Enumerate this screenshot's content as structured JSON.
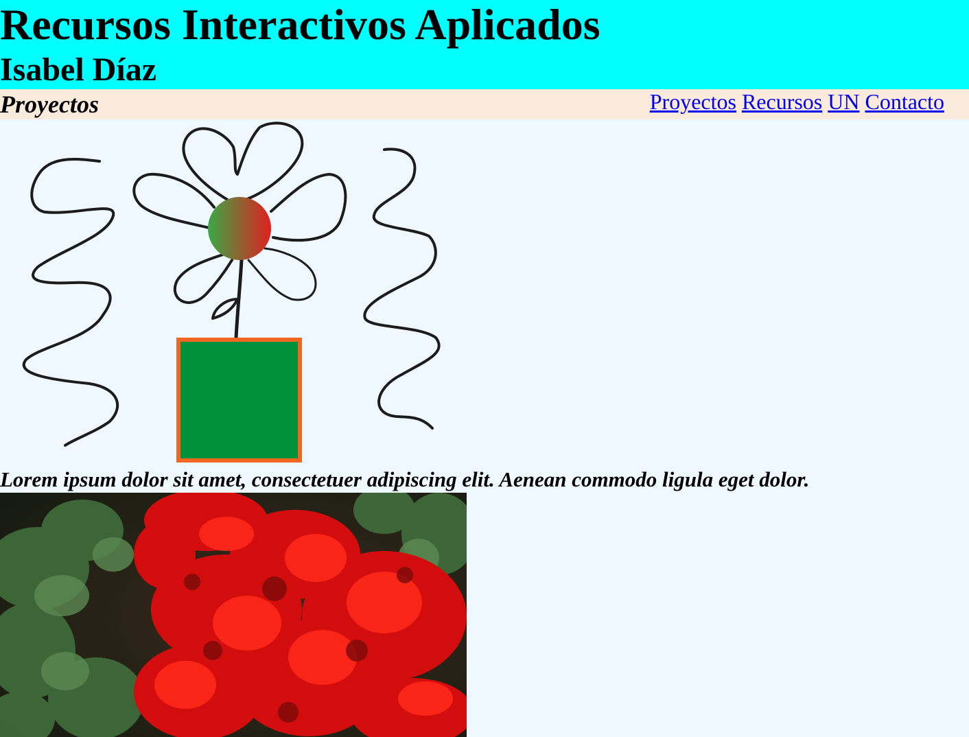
{
  "header": {
    "title": "Recursos Interactivos Aplicados",
    "author": "Isabel Díaz",
    "background": "#00ffff"
  },
  "nav": {
    "section_title": "Proyectos",
    "background": "#faebdd",
    "links": [
      {
        "label": "Proyectos"
      },
      {
        "label": "Recursos"
      },
      {
        "label": "UN"
      },
      {
        "label": "Contacto"
      }
    ]
  },
  "drawing": {
    "description_icon": "flower-drawing",
    "flower_center_gradient": [
      "#3aa845",
      "#e0201f"
    ],
    "pot_fill": "#00913a",
    "pot_border": "#f26522"
  },
  "main": {
    "caption": "Lorem ipsum dolor sit amet, consectetuer adipiscing elit. Aenean commodo ligula eget dolor."
  },
  "photo": {
    "icon": "red-geranium-photo"
  },
  "page": {
    "background": "#eff7ff"
  }
}
